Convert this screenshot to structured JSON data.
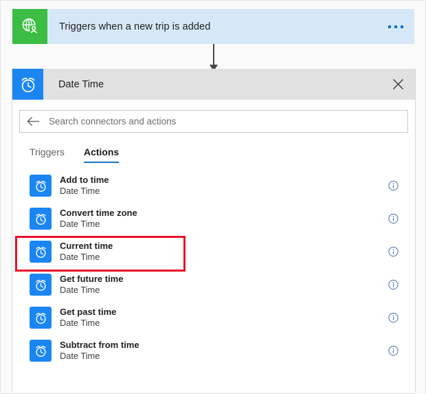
{
  "trigger": {
    "icon": "globe-person-icon",
    "title": "Triggers when a new trip is added",
    "more_label": "...",
    "accent_color": "#3cbd43",
    "background_color": "#d6e8f7"
  },
  "connector": {
    "icon": "down-arrow-icon"
  },
  "panel": {
    "icon": "alarm-clock-icon",
    "title": "Date Time",
    "close_label": "×",
    "header_color": "#e1e1e1",
    "icon_color": "#1b86f2"
  },
  "search": {
    "back_icon": "back-arrow-icon",
    "placeholder": "Search connectors and actions",
    "value": ""
  },
  "tabs": [
    {
      "label": "Triggers",
      "active": false
    },
    {
      "label": "Actions",
      "active": true
    }
  ],
  "tabs_accent_color": "#1473c4",
  "highlight_color": "#e8102a",
  "actions": [
    {
      "title": "Add to time",
      "subtitle": "Date Time",
      "icon": "alarm-clock-icon",
      "info_icon": "info-icon",
      "highlighted": false
    },
    {
      "title": "Convert time zone",
      "subtitle": "Date Time",
      "icon": "alarm-clock-icon",
      "info_icon": "info-icon",
      "highlighted": false
    },
    {
      "title": "Current time",
      "subtitle": "Date Time",
      "icon": "alarm-clock-icon",
      "info_icon": "info-icon",
      "highlighted": true
    },
    {
      "title": "Get future time",
      "subtitle": "Date Time",
      "icon": "alarm-clock-icon",
      "info_icon": "info-icon",
      "highlighted": false
    },
    {
      "title": "Get past time",
      "subtitle": "Date Time",
      "icon": "alarm-clock-icon",
      "info_icon": "info-icon",
      "highlighted": false
    },
    {
      "title": "Subtract from time",
      "subtitle": "Date Time",
      "icon": "alarm-clock-icon",
      "info_icon": "info-icon",
      "highlighted": false
    }
  ]
}
